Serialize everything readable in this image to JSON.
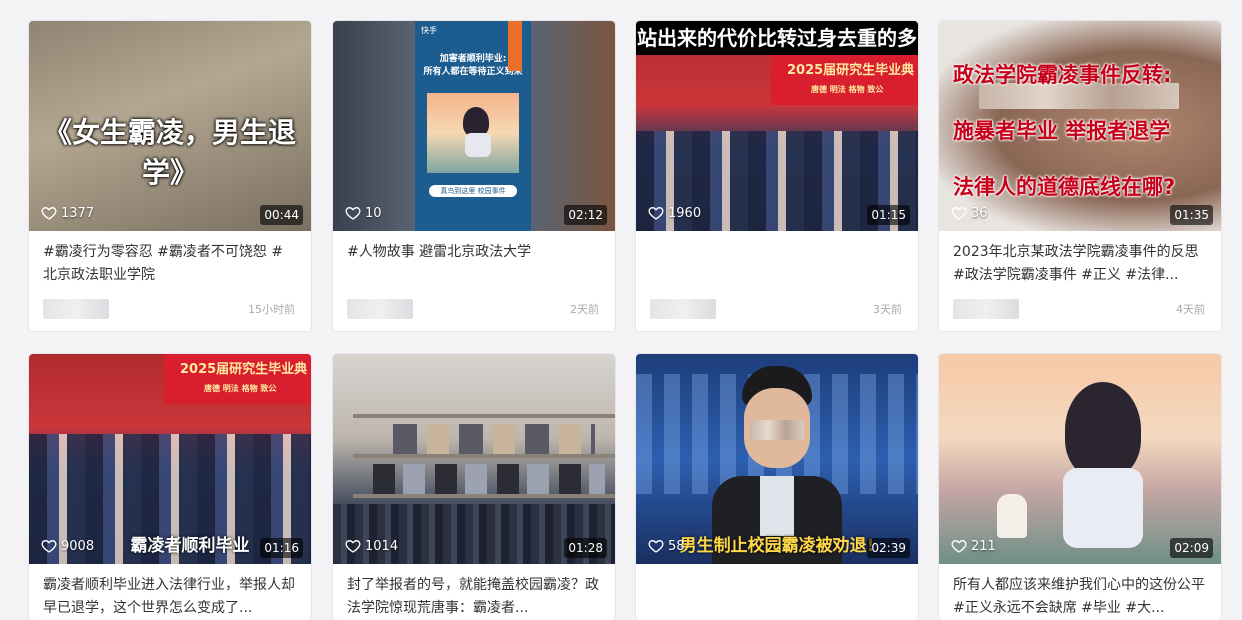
{
  "cards": [
    {
      "likes": "1377",
      "duration": "00:44",
      "desc": "#霸凌行为零容忍 #霸凌者不可饶恕 # 北京政法职业学院",
      "time": "15小时前",
      "overlay": "《女生霸凌，男生退学》"
    },
    {
      "likes": "10",
      "duration": "02:12",
      "desc": "#人物故事 避雷北京政法大学",
      "time": "2天前",
      "phone_logo": "快手",
      "phone_title": "加害者顺利毕业:\n所有人都在等待正义到来",
      "phone_badge": "真鸟到这里  校园事件"
    },
    {
      "likes": "1960",
      "duration": "01:15",
      "desc": "",
      "time": "3天前",
      "top_text": "站出来的代价比转过身去重的多",
      "banner_text": "2025届研究生毕业典",
      "banner_sub": "唐德 明法 格物 致公"
    },
    {
      "likes": "36",
      "duration": "01:35",
      "desc": "2023年北京某政法学院霸凌事件的反思#政法学院霸凌事件 #正义 #法律...",
      "time": "4天前",
      "red_lines": [
        "政法学院霸凌事件反转:",
        "施暴者毕业 举报者退学",
        "法律人的道德底线在哪?"
      ]
    },
    {
      "likes": "9008",
      "duration": "01:16",
      "desc": "霸凌者顺利毕业进入法律行业，举报人却早已退学，这个世界怎么变成了...",
      "time": "",
      "banner_text": "2025届研究生毕业典",
      "banner_sub": "唐德 明法 格物 致公",
      "caption": "霸凌者顺利毕业"
    },
    {
      "likes": "1014",
      "duration": "01:28",
      "desc": "封了举报者的号，就能掩盖校园霸凌？政法学院惊现荒唐事：霸凌者...",
      "time": ""
    },
    {
      "likes": "58",
      "duration": "02:39",
      "desc": "",
      "time": "",
      "caption": "男生制止校园霸凌被劝退!"
    },
    {
      "likes": "211",
      "duration": "02:09",
      "desc": "所有人都应该来维护我们心中的这份公平 #正义永远不会缺席 #毕业 #大...",
      "time": ""
    }
  ]
}
